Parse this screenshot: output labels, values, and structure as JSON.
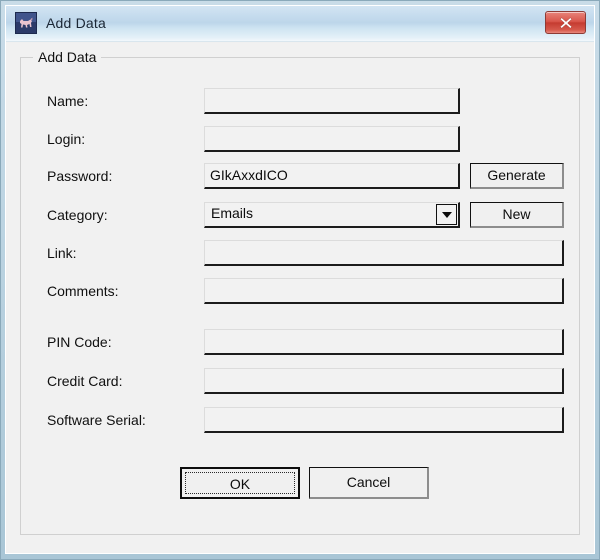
{
  "window": {
    "title": "Add Data",
    "icon": "application-icon",
    "close_label": "x",
    "accent_titlebar": "#c6dcee",
    "close_color": "#c53c31"
  },
  "groupbox": {
    "legend": "Add Data"
  },
  "fields": [
    {
      "id": "name",
      "label": "Name:",
      "value": "",
      "placeholder": ""
    },
    {
      "id": "login",
      "label": "Login:",
      "value": "",
      "placeholder": ""
    },
    {
      "id": "password",
      "label": "Password:",
      "value": "GIkAxxdICO",
      "placeholder": ""
    },
    {
      "id": "link",
      "label": "Link:",
      "value": "",
      "placeholder": ""
    },
    {
      "id": "comments",
      "label": "Comments:",
      "value": "",
      "placeholder": ""
    },
    {
      "id": "pin_code",
      "label": "PIN Code:",
      "value": "",
      "placeholder": ""
    },
    {
      "id": "credit_card",
      "label": "Credit Card:",
      "value": "",
      "placeholder": ""
    },
    {
      "id": "software_serial",
      "label": "Software Serial:",
      "value": "",
      "placeholder": ""
    }
  ],
  "category": {
    "label": "Category:",
    "selected": "Emails",
    "options": [
      "Emails"
    ],
    "arrow_icon": "chevron-down-icon"
  },
  "buttons": {
    "generate": "Generate",
    "new": "New",
    "ok": "OK",
    "cancel": "Cancel"
  }
}
